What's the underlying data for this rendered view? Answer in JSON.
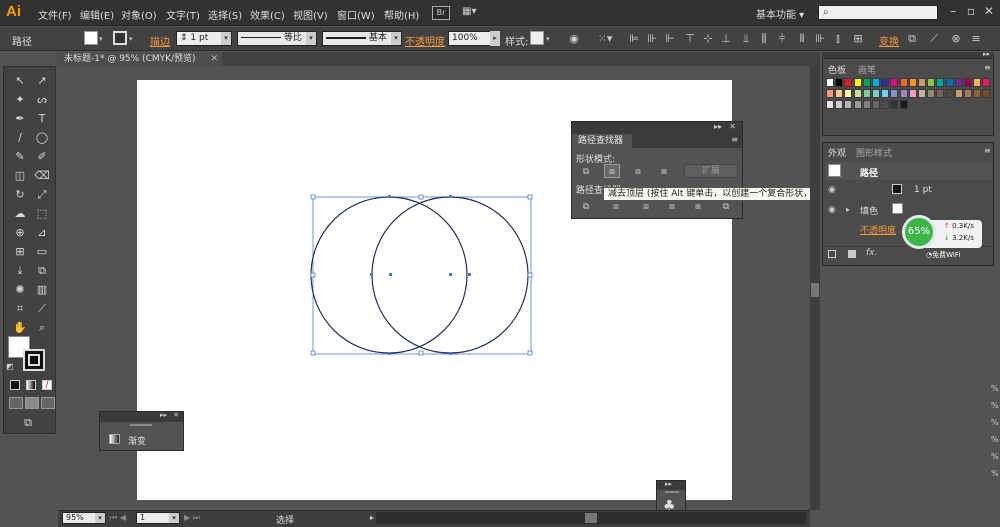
{
  "app": {
    "logo": "Ai"
  },
  "menu": [
    "文件(F)",
    "编辑(E)",
    "对象(O)",
    "文字(T)",
    "选择(S)",
    "效果(C)",
    "视图(V)",
    "窗口(W)",
    "帮助(H)"
  ],
  "bridge_label": "Br",
  "workspace_label": "基本功能",
  "control_bar": {
    "object_label": "路径",
    "stroke_label": "描边",
    "stroke_weight": "1 pt",
    "profile_label": "等比",
    "brush_label": "基本",
    "opacity_label": "不透明度",
    "opacity_value": "100%",
    "style_label": "样式:",
    "transform_label": "变换"
  },
  "document_tab": {
    "title": "未标题-1* @ 95% (CMYK/预览)"
  },
  "pathfinder_panel": {
    "title": "路径查找器",
    "shape_modes_label": "形状模式:",
    "expand_label": "扩展",
    "pathfinders_label": "路径查找器"
  },
  "tooltip": "减去顶层 (按住 Alt 键单击，以创建一个复合形状，并从形状区域中减去)",
  "gradient_panel": {
    "label": "渐变"
  },
  "color_panel": {
    "tab_swatches": "色板",
    "tab_brushes": "画笔"
  },
  "appearance_panel": {
    "tab_appearance": "外观",
    "tab_graphic_styles": "图形样式",
    "object_label": "路径",
    "stroke_weight": "1 pt",
    "fill_label": "填色",
    "opacity_label": "不透明度"
  },
  "net_widget": {
    "percent": "65%",
    "up": "0.3K/s",
    "down": "3.2K/s",
    "wifi_label": "免费WiFi"
  },
  "status_bar": {
    "zoom": "95%",
    "page": "1",
    "tool": "选择"
  },
  "scroll_marks": [
    "%",
    "%",
    "%",
    "%",
    "%",
    "%"
  ],
  "colors": {
    "menubar": "#323232",
    "panel": "#535353",
    "accent_orange": "#f39a3b",
    "path_stroke": "#1f2f5a",
    "selection": "#4a7bd0",
    "net_green": "#3bb54a"
  },
  "swatch_colors": [
    [
      "#ffffff",
      "#000000",
      "#ed1c24",
      "#fff200",
      "#00a651",
      "#00aeef",
      "#2e3192",
      "#ec008c",
      "#f26522",
      "#f7941d",
      "#c69c6d",
      "#8dc63f",
      "#00a99d",
      "#0072bc",
      "#662d91",
      "#9e005d",
      "#fbaf5d",
      "#ed145b"
    ],
    [
      "#f7977a",
      "#fdc68a",
      "#fff79a",
      "#c4df9b",
      "#82ca9c",
      "#7accc8",
      "#6dcff6",
      "#8393ca",
      "#a187be",
      "#f49ac2",
      "#c7b299",
      "#998675",
      "#736357",
      "#534741",
      "#c69c6d",
      "#a67c52",
      "#8c6239",
      "#754c24"
    ],
    [
      "#e6e6e6",
      "#cccccc",
      "#b3b3b3",
      "#999999",
      "#808080",
      "#666666",
      "#4d4d4d",
      "#333333",
      "#1a1a1a"
    ]
  ]
}
